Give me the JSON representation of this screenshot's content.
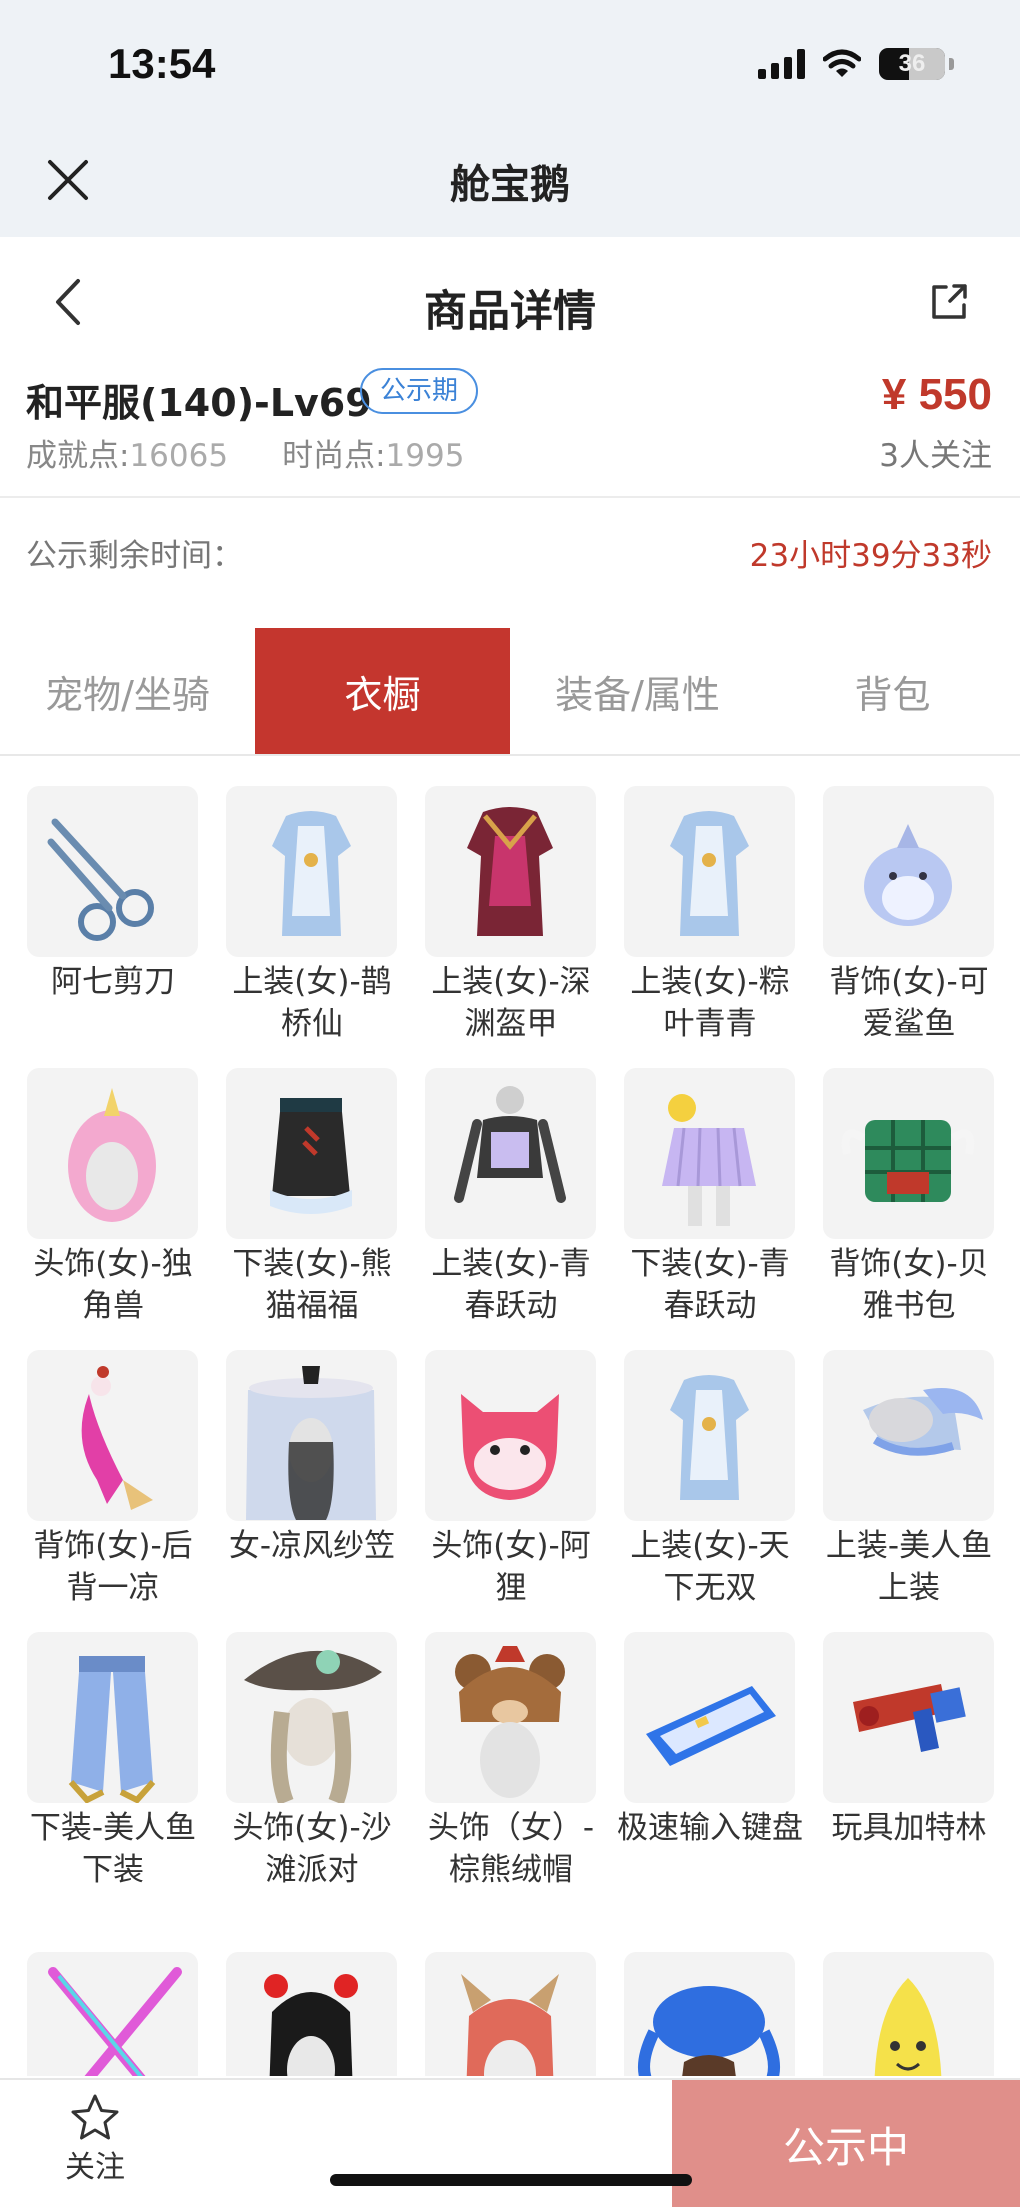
{
  "status_bar": {
    "time": "13:54",
    "battery": "36"
  },
  "app_bar": {
    "title": "舱宝鹅"
  },
  "header": {
    "title": "商品详情"
  },
  "product": {
    "name": "和平服(140)-Lv69",
    "badge": "公示期",
    "price": "¥ 550",
    "achievement_label": "成就点:",
    "achievement_value": "16065",
    "fashion_label": "时尚点:",
    "fashion_value": "1995",
    "followers": "3人关注"
  },
  "countdown": {
    "label": "公示剩余时间：",
    "value": "23小时39分33秒"
  },
  "tabs": [
    {
      "label": "宠物/坐骑",
      "active": false
    },
    {
      "label": "衣橱",
      "active": true
    },
    {
      "label": "装备/属性",
      "active": false
    },
    {
      "label": "背包",
      "active": false
    }
  ],
  "items": [
    {
      "label": "阿七剪刀",
      "icon": "scissors-icon"
    },
    {
      "label": "上装(女)-鹊桥仙",
      "icon": "outfit-top-icon"
    },
    {
      "label": "上装(女)-深渊盔甲",
      "icon": "armor-top-icon"
    },
    {
      "label": "上装(女)-粽叶青青",
      "icon": "outfit-top-icon"
    },
    {
      "label": "背饰(女)-可爱鲨鱼",
      "icon": "shark-backpack-icon"
    },
    {
      "label": "头饰(女)-独角兽",
      "icon": "unicorn-hood-icon"
    },
    {
      "label": "下装(女)-熊猫福福",
      "icon": "skirt-icon"
    },
    {
      "label": "上装(女)-青春跃动",
      "icon": "crop-top-icon"
    },
    {
      "label": "下装(女)-青春跃动",
      "icon": "pleated-skirt-icon"
    },
    {
      "label": "背饰(女)-贝雅书包",
      "icon": "schoolbag-icon"
    },
    {
      "label": "背饰(女)-后背一凉",
      "icon": "ice-cream-icon"
    },
    {
      "label": "女-凉风纱笠",
      "icon": "veil-hat-icon"
    },
    {
      "label": "头饰(女)-阿狸",
      "icon": "fox-head-icon"
    },
    {
      "label": "上装(女)-天下无双",
      "icon": "outfit-top-icon"
    },
    {
      "label": "上装-美人鱼上装",
      "icon": "mermaid-top-icon"
    },
    {
      "label": "下装-美人鱼下装",
      "icon": "mermaid-pants-icon"
    },
    {
      "label": "头饰(女)-沙滩派对",
      "icon": "beach-hat-icon"
    },
    {
      "label": "头饰（女）-棕熊绒帽",
      "icon": "bear-hat-icon"
    },
    {
      "label": "极速输入键盘",
      "icon": "keyboard-icon"
    },
    {
      "label": "玩具加特林",
      "icon": "toy-gun-icon"
    },
    {
      "label": "",
      "icon": "crossed-sticks-icon"
    },
    {
      "label": "",
      "icon": "heart-headband-icon"
    },
    {
      "label": "",
      "icon": "horned-hair-icon"
    },
    {
      "label": "",
      "icon": "octopus-hat-icon"
    },
    {
      "label": "",
      "icon": "banana-icon"
    }
  ],
  "bottom_bar": {
    "follow_label": "关注",
    "status_label": "公示中"
  },
  "colors": {
    "accent": "#c4362e",
    "price": "#c0392b",
    "badge": "#3b82d6",
    "status_button": "#e08f8a"
  }
}
